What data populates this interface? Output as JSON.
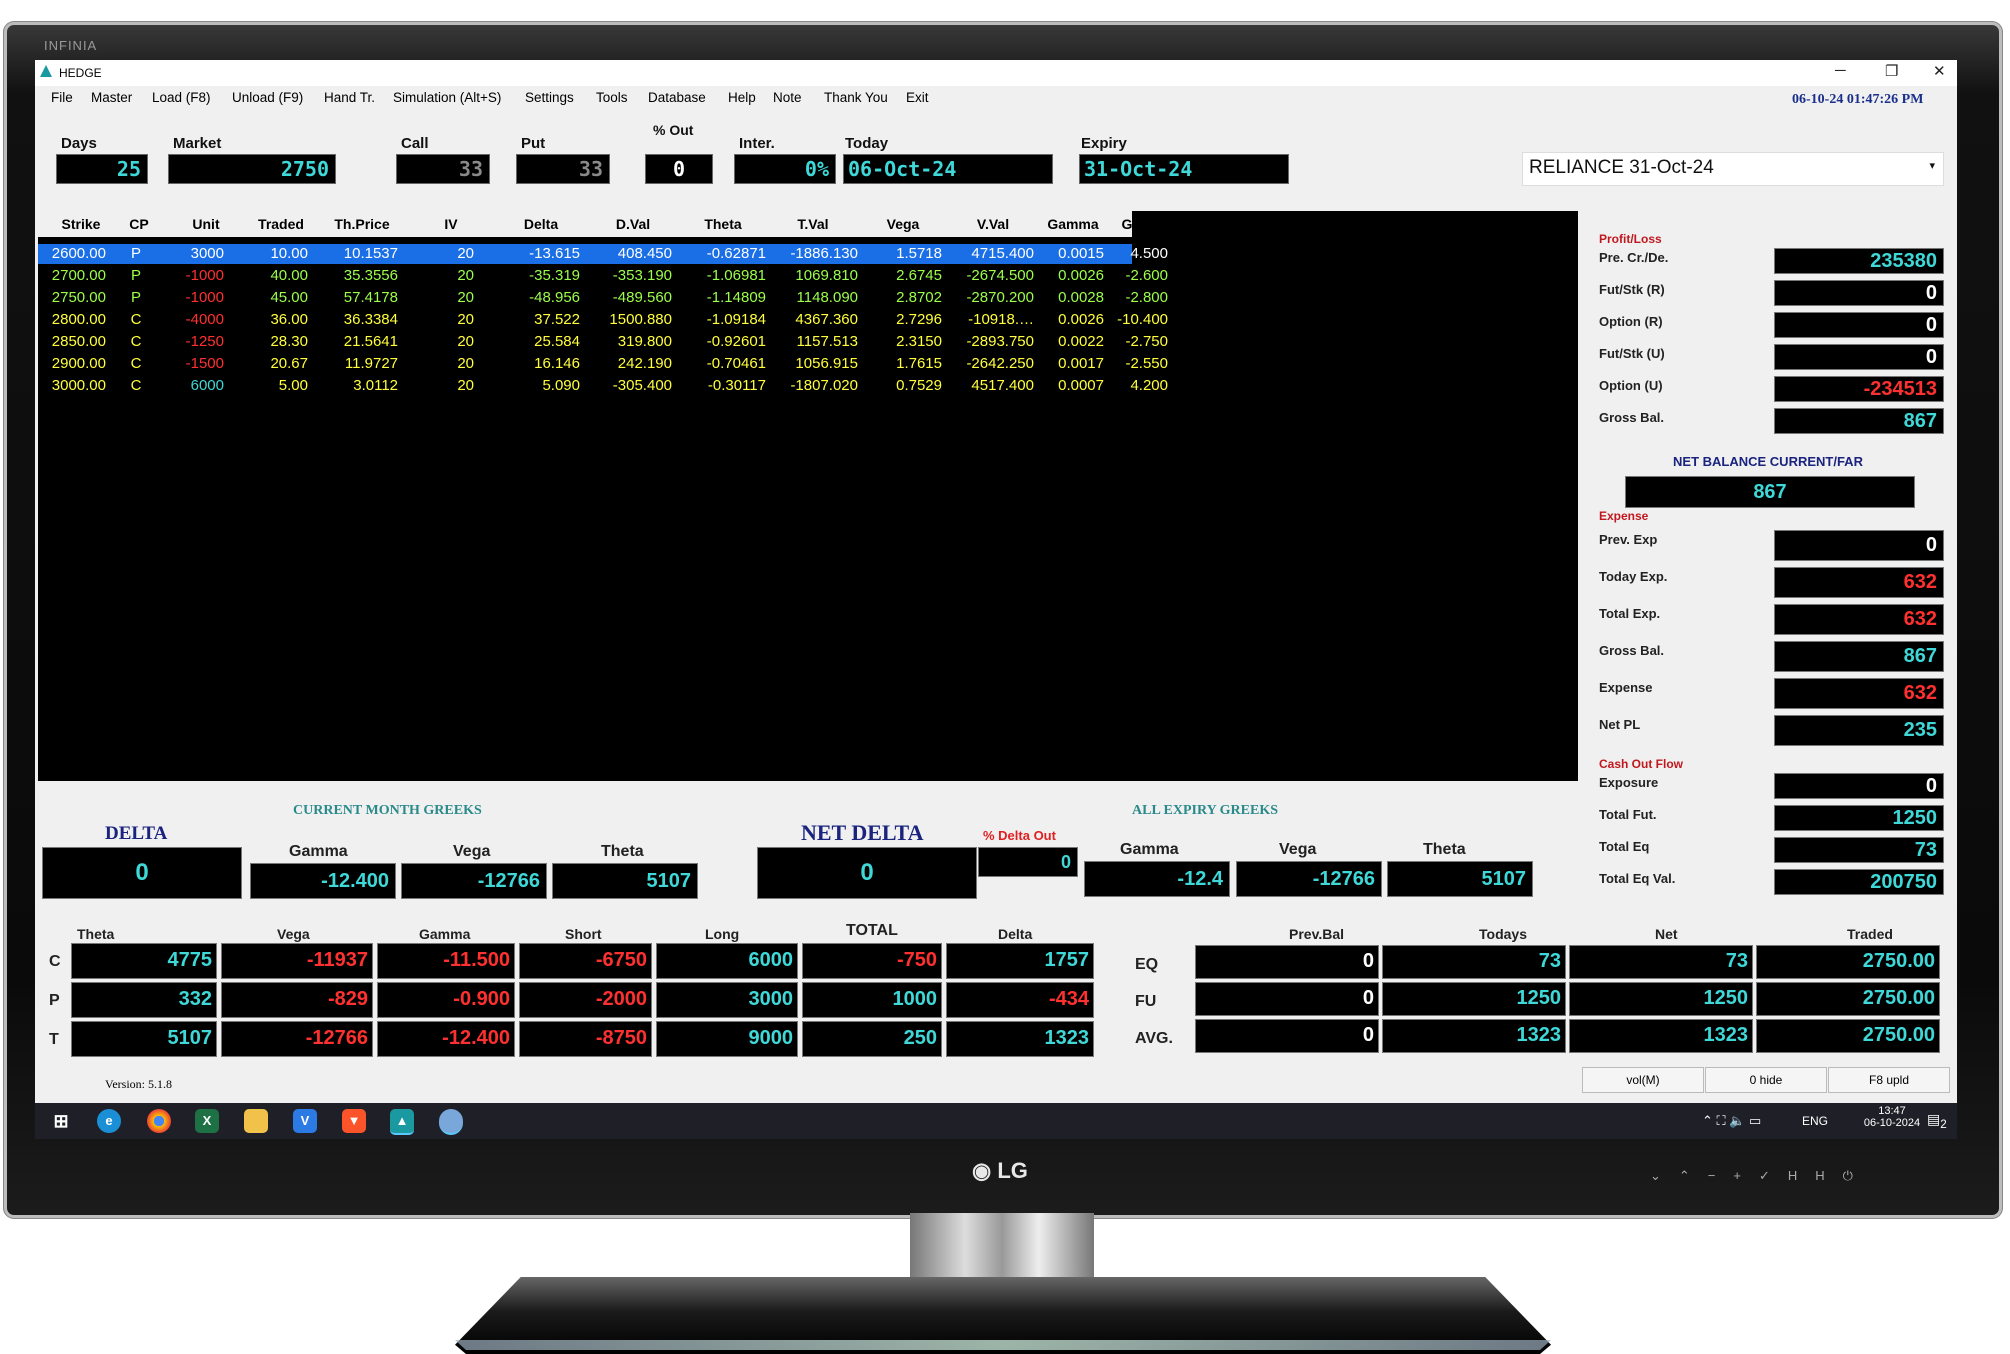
{
  "window": {
    "title": "HEDGE",
    "brand": "INFINIA",
    "datetime": "06-10-24 01:47:26 PM",
    "minimize": "─",
    "restore": "❐",
    "close": "✕"
  },
  "menu": [
    "File",
    "Master",
    "Load (F8)",
    "Unload (F9)",
    "Hand Tr.",
    "Simulation (Alt+S)",
    "Settings",
    "Tools",
    "Database",
    "Help",
    "Note",
    "Thank You",
    "Exit"
  ],
  "params": {
    "days_label": "Days",
    "days": "25",
    "market_label": "Market",
    "market": "2750",
    "call_label": "Call",
    "call": "33",
    "put_label": "Put",
    "put": "33",
    "pct_out_label": "% Out",
    "pct_out": "0",
    "inter_label": "Inter.",
    "inter": "0%",
    "today_label": "Today",
    "today": "06-Oct-24",
    "expiry_label": "Expiry",
    "expiry": "31-Oct-24",
    "symbol": "RELIANCE 31-Oct-24"
  },
  "grid": {
    "headers": [
      "Strike",
      "CP",
      "Unit",
      "Traded",
      "Th.Price",
      "IV",
      "Delta",
      "D.Val",
      "Theta",
      "T.Val",
      "Vega",
      "V.Val",
      "Gamma",
      "G.Val"
    ],
    "rows": [
      [
        "2600.00",
        "P",
        "3000",
        "10.00",
        "10.1537",
        "20",
        "-13.615",
        "408.450",
        "-0.62871",
        "-1886.130",
        "1.5718",
        "4715.400",
        "0.0015",
        "4.500"
      ],
      [
        "2700.00",
        "P",
        "-1000",
        "40.00",
        "35.3556",
        "20",
        "-35.319",
        "-353.190",
        "-1.06981",
        "1069.810",
        "2.6745",
        "-2674.500",
        "0.0026",
        "-2.600"
      ],
      [
        "2750.00",
        "P",
        "-1000",
        "45.00",
        "57.4178",
        "20",
        "-48.956",
        "-489.560",
        "-1.14809",
        "1148.090",
        "2.8702",
        "-2870.200",
        "0.0028",
        "-2.800"
      ],
      [
        "2800.00",
        "C",
        "-4000",
        "36.00",
        "36.3384",
        "20",
        "37.522",
        "1500.880",
        "-1.09184",
        "4367.360",
        "2.7296",
        "-10918.…",
        "0.0026",
        "-10.400"
      ],
      [
        "2850.00",
        "C",
        "-1250",
        "28.30",
        "21.5641",
        "20",
        "25.584",
        "319.800",
        "-0.92601",
        "1157.513",
        "2.3150",
        "-2893.750",
        "0.0022",
        "-2.750"
      ],
      [
        "2900.00",
        "C",
        "-1500",
        "20.67",
        "11.9727",
        "20",
        "16.146",
        "242.190",
        "-0.70461",
        "1056.915",
        "1.7615",
        "-2642.250",
        "0.0017",
        "-2.550"
      ],
      [
        "3000.00",
        "C",
        "6000",
        "5.00",
        "3.0112",
        "20",
        "5.090",
        "-305.400",
        "-0.30117",
        "-1807.020",
        "0.7529",
        "4517.400",
        "0.0007",
        "4.200"
      ]
    ]
  },
  "profit_loss": {
    "section": "Profit/Loss",
    "items": [
      {
        "label": "Pre. Cr./De.",
        "value": "235380",
        "color": "#3fd8d8"
      },
      {
        "label": "Fut/Stk (R)",
        "value": "0",
        "color": "#ffffff"
      },
      {
        "label": "Option (R)",
        "value": "0",
        "color": "#ffffff"
      },
      {
        "label": "Fut/Stk (U)",
        "value": "0",
        "color": "#ffffff"
      },
      {
        "label": "Option (U)",
        "value": "-234513",
        "color": "#ff3030"
      },
      {
        "label": "Gross Bal.",
        "value": "867",
        "color": "#3fd8d8"
      }
    ],
    "net_balance_label": "NET BALANCE CURRENT/FAR",
    "net_balance": "867"
  },
  "expense": {
    "section": "Expense",
    "items": [
      {
        "label": "Prev. Exp",
        "value": "0",
        "color": "#ffffff"
      },
      {
        "label": "Today Exp.",
        "value": "632",
        "color": "#ff3030"
      },
      {
        "label": "Total Exp.",
        "value": "632",
        "color": "#ff3030"
      },
      {
        "label": "Gross Bal.",
        "value": "867",
        "color": "#3fd8d8"
      },
      {
        "label": "Expense",
        "value": "632",
        "color": "#ff3030"
      },
      {
        "label": "Net PL",
        "value": "235",
        "color": "#3fd8d8"
      }
    ]
  },
  "cash_out": {
    "section": "Cash Out Flow",
    "items": [
      {
        "label": "Exposure",
        "value": "0",
        "color": "#ffffff"
      },
      {
        "label": "Total Fut.",
        "value": "1250",
        "color": "#3fd8d8"
      },
      {
        "label": "Total Eq",
        "value": "73",
        "color": "#3fd8d8"
      },
      {
        "label": "Total Eq Val.",
        "value": "200750",
        "color": "#3fd8d8"
      }
    ]
  },
  "current_greeks": {
    "delta_label": "DELTA",
    "delta": "0",
    "title": "CURRENT MONTH GREEKS",
    "gamma_label": "Gamma",
    "gamma": "-12.400",
    "vega_label": "Vega",
    "vega": "-12766",
    "theta_label": "Theta",
    "theta": "5107"
  },
  "all_greeks": {
    "net_delta_label": "NET DELTA",
    "net_delta": "0",
    "pct_delta_out_label": "% Delta Out",
    "pct_delta_out": "0",
    "title": "ALL EXPIRY GREEKS",
    "gamma_label": "Gamma",
    "gamma": "-12.4",
    "vega_label": "Vega",
    "vega": "-12766",
    "theta_label": "Theta",
    "theta": "5107"
  },
  "summary": {
    "headers": [
      "Theta",
      "Vega",
      "Gamma",
      "Short",
      "Long",
      "TOTAL",
      "Delta"
    ],
    "rows": [
      {
        "label": "C",
        "values": [
          "4775",
          "-11937",
          "-11.500",
          "-6750",
          "6000",
          "-750",
          "1757"
        ]
      },
      {
        "label": "P",
        "values": [
          "332",
          "-829",
          "-0.900",
          "-2000",
          "3000",
          "1000",
          "-434"
        ]
      },
      {
        "label": "T",
        "values": [
          "5107",
          "-12766",
          "-12.400",
          "-8750",
          "9000",
          "250",
          "1323"
        ]
      }
    ]
  },
  "positions": {
    "headers": [
      "Prev.Bal",
      "Todays",
      "Net",
      "Traded"
    ],
    "rows": [
      {
        "label": "EQ",
        "values": [
          "0",
          "73",
          "73",
          "2750.00"
        ]
      },
      {
        "label": "FU",
        "values": [
          "0",
          "1250",
          "1250",
          "2750.00"
        ]
      },
      {
        "label": "AVG.",
        "values": [
          "0",
          "1323",
          "1323",
          "2750.00"
        ]
      }
    ]
  },
  "footer": {
    "version": "Version: 5.1.8",
    "buttons": [
      "vol(M)",
      "0 hide",
      "F8 upld"
    ]
  },
  "taskbar": {
    "lang": "ENG",
    "time": "13:47",
    "date": "06-10-2024",
    "notif": "2"
  },
  "monitor": {
    "logo": "LG"
  }
}
